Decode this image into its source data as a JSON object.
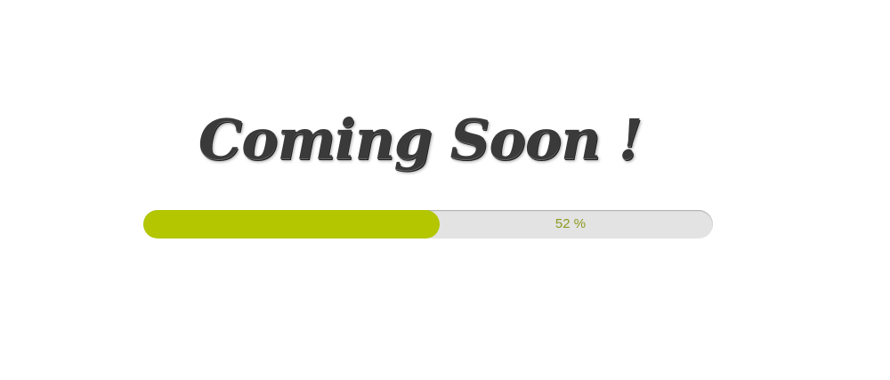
{
  "headline": "Coming Soon !",
  "progress": {
    "percent": 52,
    "label": "52 %",
    "fill_color": "#b3c600",
    "track_color": "#e3e3e3",
    "label_color": "#8c9a1e"
  }
}
